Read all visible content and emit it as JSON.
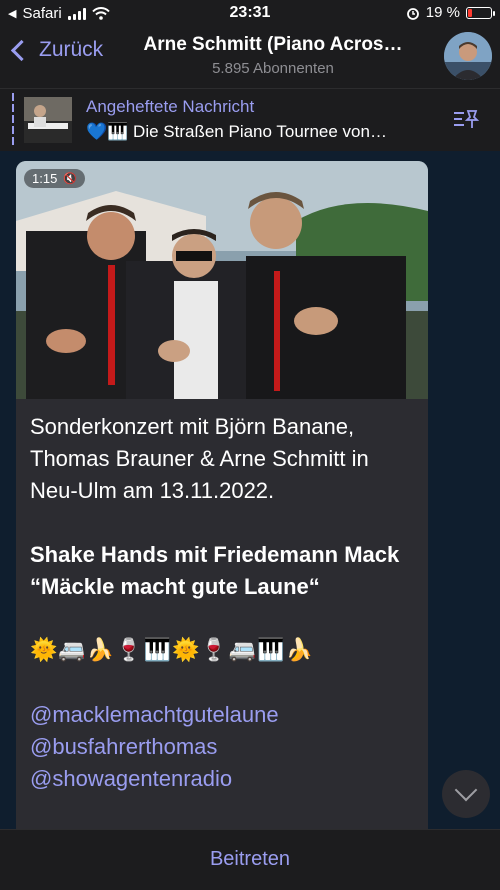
{
  "status": {
    "carrier": "Safari",
    "time": "23:31",
    "battery": "19 %",
    "battery_level": 0.19
  },
  "nav": {
    "back_label": "Zurück",
    "title": "Arne Schmitt (Piano Acros…",
    "subtitle": "5.895 Abonnenten"
  },
  "pinned": {
    "label": "Angeheftete Nachricht",
    "text": "💙🎹 Die Straßen Piano Tournee von…"
  },
  "message": {
    "video_duration": "1:15",
    "paragraph1": "Sonderkonzert mit Björn Banane, Thomas Brauner & Arne Schmitt in Neu-Ulm am 13.11.2022.",
    "paragraph2": "Shake Hands mit Friedemann Mack “Mäckle macht gute Laune“",
    "emojis": "🌞🚐🍌🍷🎹🌞🍷🚐🎹🍌",
    "mentions": [
      "@macklemachtgutelaune",
      "@busfahrerthomas",
      "@showagentenradio"
    ]
  },
  "bottom": {
    "join_label": "Beitreten"
  },
  "colors": {
    "accent": "#9a9df0",
    "bubble": "#2c2c31",
    "background": "#1c1c1e"
  }
}
